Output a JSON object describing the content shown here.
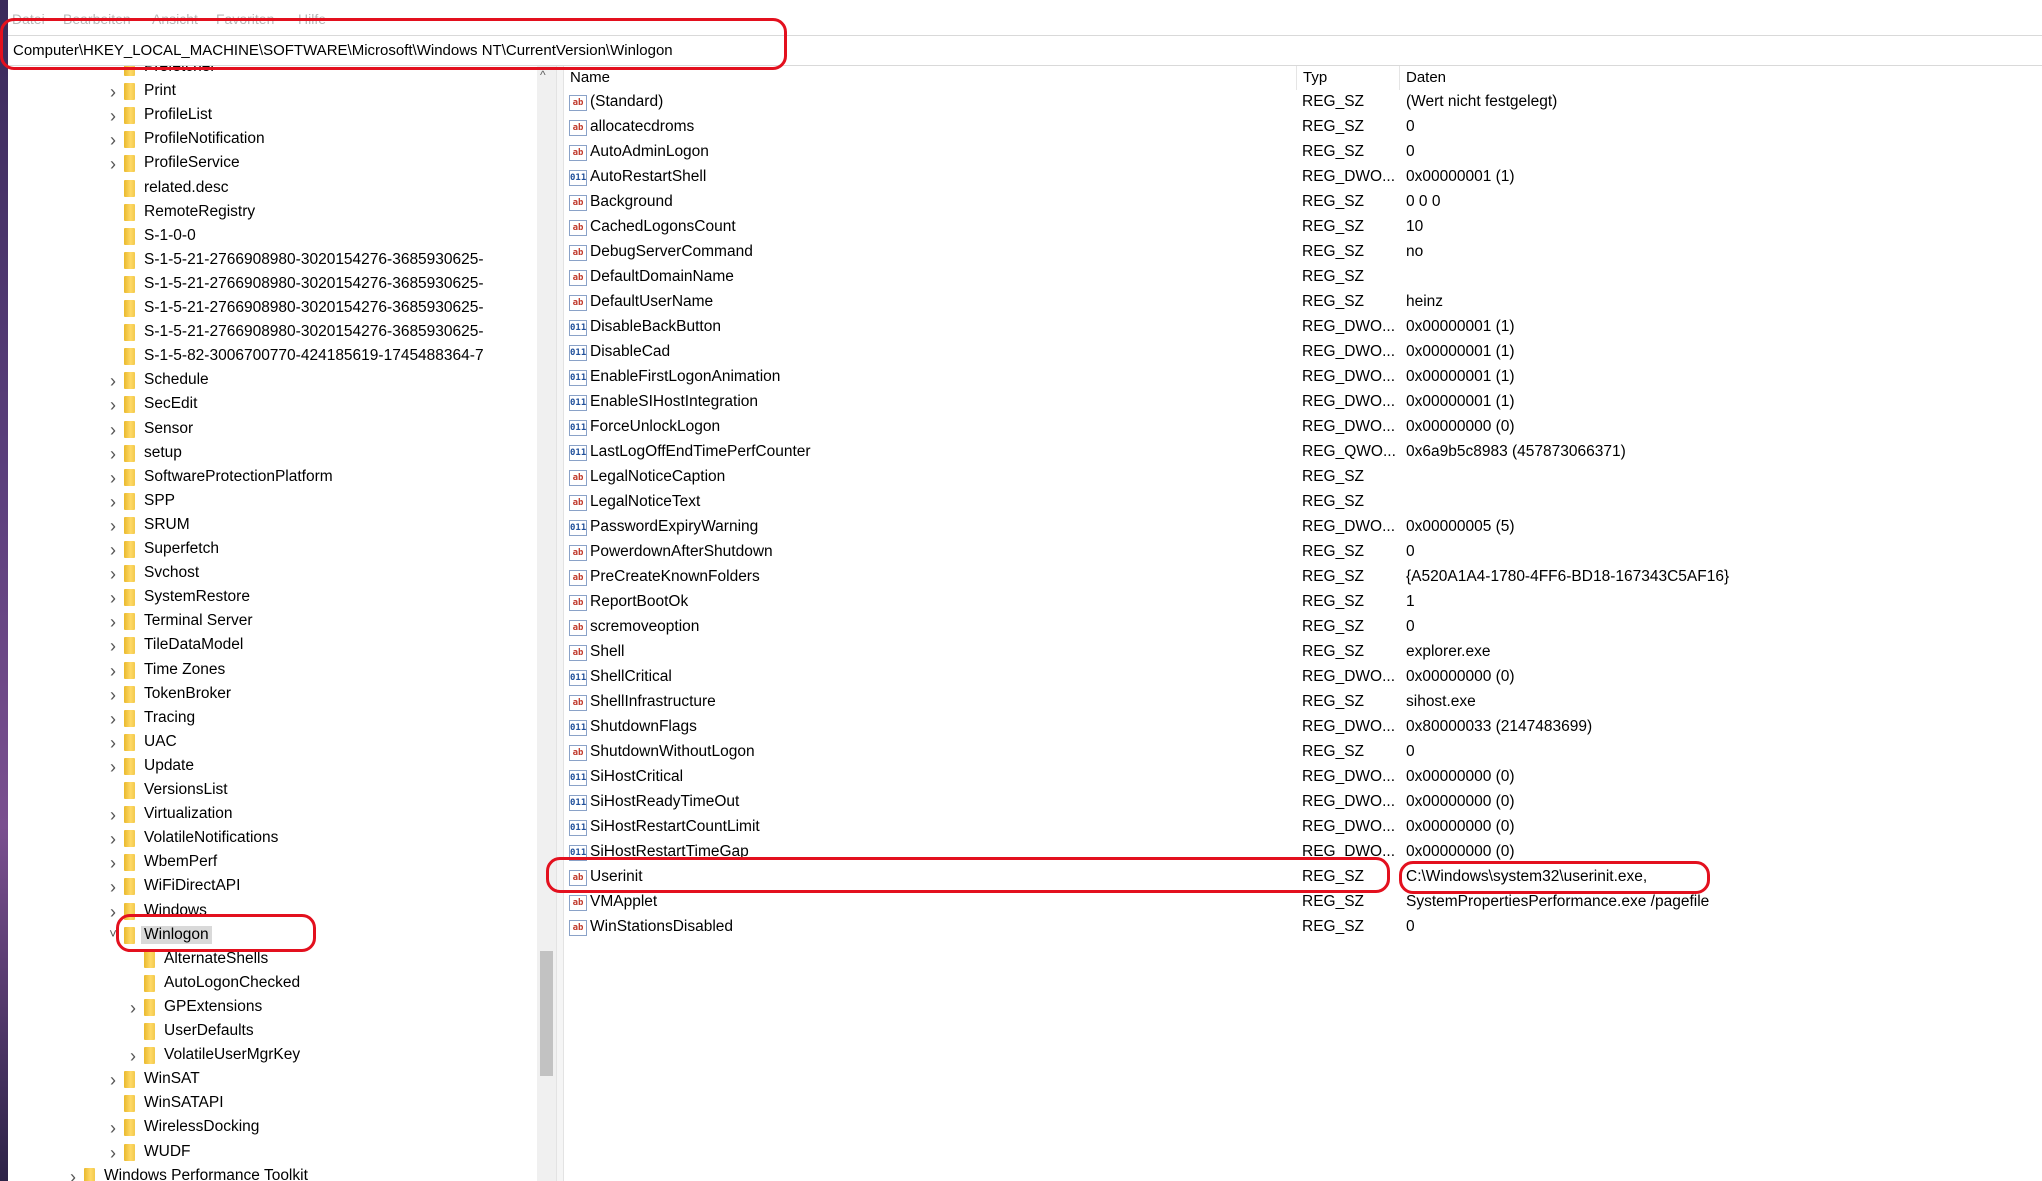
{
  "menu": [
    "Datei",
    "Bearbeiten",
    "Ansicht",
    "Favoriten",
    "Hilfe"
  ],
  "address": "Computer\\HKEY_LOCAL_MACHINE\\SOFTWARE\\Microsoft\\Windows NT\\CurrentVersion\\Winlogon",
  "tree": [
    {
      "label": "Prefetcher",
      "level": 1,
      "expand": "none"
    },
    {
      "label": "Print",
      "level": 1,
      "expand": "closed"
    },
    {
      "label": "ProfileList",
      "level": 1,
      "expand": "closed"
    },
    {
      "label": "ProfileNotification",
      "level": 1,
      "expand": "closed"
    },
    {
      "label": "ProfileService",
      "level": 1,
      "expand": "closed"
    },
    {
      "label": "related.desc",
      "level": 1,
      "expand": "none"
    },
    {
      "label": "RemoteRegistry",
      "level": 1,
      "expand": "none"
    },
    {
      "label": "S-1-0-0",
      "level": 1,
      "expand": "none"
    },
    {
      "label": "S-1-5-21-2766908980-3020154276-3685930625-",
      "level": 1,
      "expand": "none"
    },
    {
      "label": "S-1-5-21-2766908980-3020154276-3685930625-",
      "level": 1,
      "expand": "none"
    },
    {
      "label": "S-1-5-21-2766908980-3020154276-3685930625-",
      "level": 1,
      "expand": "none"
    },
    {
      "label": "S-1-5-21-2766908980-3020154276-3685930625-",
      "level": 1,
      "expand": "none"
    },
    {
      "label": "S-1-5-82-3006700770-424185619-1745488364-7",
      "level": 1,
      "expand": "none"
    },
    {
      "label": "Schedule",
      "level": 1,
      "expand": "closed"
    },
    {
      "label": "SecEdit",
      "level": 1,
      "expand": "closed"
    },
    {
      "label": "Sensor",
      "level": 1,
      "expand": "closed"
    },
    {
      "label": "setup",
      "level": 1,
      "expand": "closed"
    },
    {
      "label": "SoftwareProtectionPlatform",
      "level": 1,
      "expand": "closed"
    },
    {
      "label": "SPP",
      "level": 1,
      "expand": "closed"
    },
    {
      "label": "SRUM",
      "level": 1,
      "expand": "closed"
    },
    {
      "label": "Superfetch",
      "level": 1,
      "expand": "closed"
    },
    {
      "label": "Svchost",
      "level": 1,
      "expand": "closed"
    },
    {
      "label": "SystemRestore",
      "level": 1,
      "expand": "closed"
    },
    {
      "label": "Terminal Server",
      "level": 1,
      "expand": "closed"
    },
    {
      "label": "TileDataModel",
      "level": 1,
      "expand": "closed"
    },
    {
      "label": "Time Zones",
      "level": 1,
      "expand": "closed"
    },
    {
      "label": "TokenBroker",
      "level": 1,
      "expand": "closed"
    },
    {
      "label": "Tracing",
      "level": 1,
      "expand": "closed"
    },
    {
      "label": "UAC",
      "level": 1,
      "expand": "closed"
    },
    {
      "label": "Update",
      "level": 1,
      "expand": "closed"
    },
    {
      "label": "VersionsList",
      "level": 1,
      "expand": "none"
    },
    {
      "label": "Virtualization",
      "level": 1,
      "expand": "closed"
    },
    {
      "label": "VolatileNotifications",
      "level": 1,
      "expand": "closed"
    },
    {
      "label": "WbemPerf",
      "level": 1,
      "expand": "closed"
    },
    {
      "label": "WiFiDirectAPI",
      "level": 1,
      "expand": "closed"
    },
    {
      "label": "Windows",
      "level": 1,
      "expand": "closed"
    },
    {
      "label": "Winlogon",
      "level": 1,
      "expand": "open",
      "selected": true
    },
    {
      "label": "AlternateShells",
      "level": 2,
      "expand": "none"
    },
    {
      "label": "AutoLogonChecked",
      "level": 2,
      "expand": "none"
    },
    {
      "label": "GPExtensions",
      "level": 2,
      "expand": "closed"
    },
    {
      "label": "UserDefaults",
      "level": 2,
      "expand": "none"
    },
    {
      "label": "VolatileUserMgrKey",
      "level": 2,
      "expand": "closed"
    },
    {
      "label": "WinSAT",
      "level": 1,
      "expand": "closed"
    },
    {
      "label": "WinSATAPI",
      "level": 1,
      "expand": "none"
    },
    {
      "label": "WirelessDocking",
      "level": 1,
      "expand": "closed"
    },
    {
      "label": "WUDF",
      "level": 1,
      "expand": "closed"
    },
    {
      "label": "Windows Performance Toolkit",
      "level": 0,
      "expand": "closed"
    }
  ],
  "columns": {
    "name": "Name",
    "type": "Typ",
    "data": "Daten"
  },
  "values": [
    {
      "name": "(Standard)",
      "type": "REG_SZ",
      "data": "(Wert nicht festgelegt)",
      "icon": "ab"
    },
    {
      "name": "allocatecdroms",
      "type": "REG_SZ",
      "data": "0",
      "icon": "ab"
    },
    {
      "name": "AutoAdminLogon",
      "type": "REG_SZ",
      "data": "0",
      "icon": "ab"
    },
    {
      "name": "AutoRestartShell",
      "type": "REG_DWO...",
      "data": "0x00000001 (1)",
      "icon": "bin"
    },
    {
      "name": "Background",
      "type": "REG_SZ",
      "data": "0 0 0",
      "icon": "ab"
    },
    {
      "name": "CachedLogonsCount",
      "type": "REG_SZ",
      "data": "10",
      "icon": "ab"
    },
    {
      "name": "DebugServerCommand",
      "type": "REG_SZ",
      "data": "no",
      "icon": "ab"
    },
    {
      "name": "DefaultDomainName",
      "type": "REG_SZ",
      "data": "",
      "icon": "ab"
    },
    {
      "name": "DefaultUserName",
      "type": "REG_SZ",
      "data": "heinz",
      "icon": "ab"
    },
    {
      "name": "DisableBackButton",
      "type": "REG_DWO...",
      "data": "0x00000001 (1)",
      "icon": "bin"
    },
    {
      "name": "DisableCad",
      "type": "REG_DWO...",
      "data": "0x00000001 (1)",
      "icon": "bin"
    },
    {
      "name": "EnableFirstLogonAnimation",
      "type": "REG_DWO...",
      "data": "0x00000001 (1)",
      "icon": "bin"
    },
    {
      "name": "EnableSIHostIntegration",
      "type": "REG_DWO...",
      "data": "0x00000001 (1)",
      "icon": "bin"
    },
    {
      "name": "ForceUnlockLogon",
      "type": "REG_DWO...",
      "data": "0x00000000 (0)",
      "icon": "bin"
    },
    {
      "name": "LastLogOffEndTimePerfCounter",
      "type": "REG_QWO...",
      "data": "0x6a9b5c8983 (457873066371)",
      "icon": "bin"
    },
    {
      "name": "LegalNoticeCaption",
      "type": "REG_SZ",
      "data": "",
      "icon": "ab"
    },
    {
      "name": "LegalNoticeText",
      "type": "REG_SZ",
      "data": "",
      "icon": "ab"
    },
    {
      "name": "PasswordExpiryWarning",
      "type": "REG_DWO...",
      "data": "0x00000005 (5)",
      "icon": "bin"
    },
    {
      "name": "PowerdownAfterShutdown",
      "type": "REG_SZ",
      "data": "0",
      "icon": "ab"
    },
    {
      "name": "PreCreateKnownFolders",
      "type": "REG_SZ",
      "data": "{A520A1A4-1780-4FF6-BD18-167343C5AF16}",
      "icon": "ab"
    },
    {
      "name": "ReportBootOk",
      "type": "REG_SZ",
      "data": "1",
      "icon": "ab"
    },
    {
      "name": "scremoveoption",
      "type": "REG_SZ",
      "data": "0",
      "icon": "ab"
    },
    {
      "name": "Shell",
      "type": "REG_SZ",
      "data": "explorer.exe",
      "icon": "ab"
    },
    {
      "name": "ShellCritical",
      "type": "REG_DWO...",
      "data": "0x00000000 (0)",
      "icon": "bin"
    },
    {
      "name": "ShellInfrastructure",
      "type": "REG_SZ",
      "data": "sihost.exe",
      "icon": "ab"
    },
    {
      "name": "ShutdownFlags",
      "type": "REG_DWO...",
      "data": "0x80000033 (2147483699)",
      "icon": "bin"
    },
    {
      "name": "ShutdownWithoutLogon",
      "type": "REG_SZ",
      "data": "0",
      "icon": "ab"
    },
    {
      "name": "SiHostCritical",
      "type": "REG_DWO...",
      "data": "0x00000000 (0)",
      "icon": "bin"
    },
    {
      "name": "SiHostReadyTimeOut",
      "type": "REG_DWO...",
      "data": "0x00000000 (0)",
      "icon": "bin"
    },
    {
      "name": "SiHostRestartCountLimit",
      "type": "REG_DWO...",
      "data": "0x00000000 (0)",
      "icon": "bin"
    },
    {
      "name": "SiHostRestartTimeGap",
      "type": "REG_DWO...",
      "data": "0x00000000 (0)",
      "icon": "bin"
    },
    {
      "name": "Userinit",
      "type": "REG_SZ",
      "data": "C:\\Windows\\system32\\userinit.exe,",
      "icon": "ab"
    },
    {
      "name": "VMApplet",
      "type": "REG_SZ",
      "data": "SystemPropertiesPerformance.exe /pagefile",
      "icon": "ab"
    },
    {
      "name": "WinStationsDisabled",
      "type": "REG_SZ",
      "data": "0",
      "icon": "ab"
    }
  ]
}
